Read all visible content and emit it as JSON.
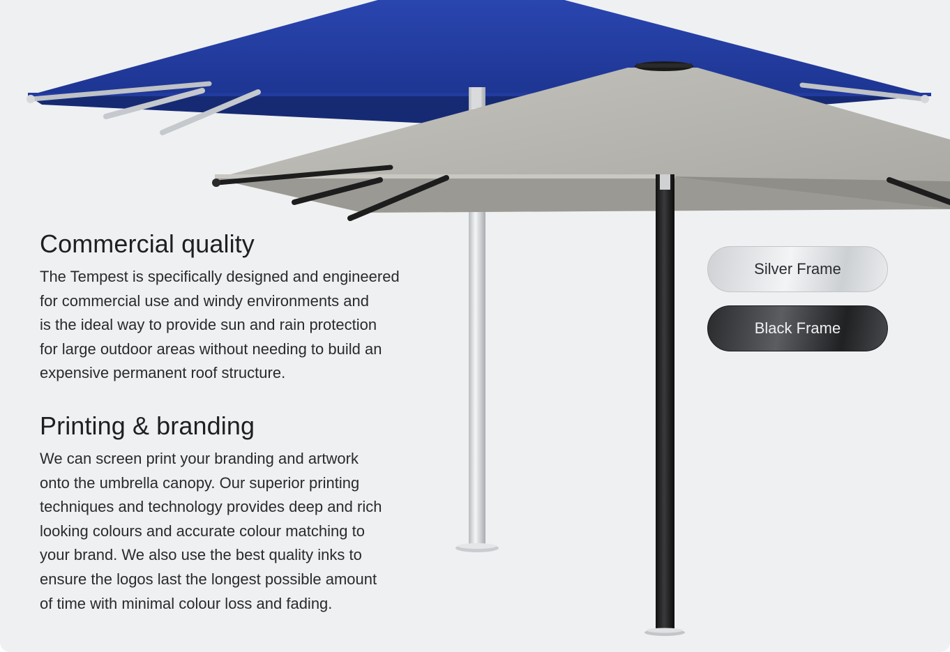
{
  "sections": [
    {
      "heading": "Commercial quality",
      "lines": [
        "The Tempest is specifically designed and engineered",
        "for commercial use and windy environments and",
        "is the ideal way to provide sun and rain protection",
        "for large outdoor areas without needing to build an",
        "expensive permanent roof structure."
      ]
    },
    {
      "heading": "Printing & branding",
      "lines": [
        "We can screen print your branding and artwork",
        "onto the umbrella canopy. Our superior printing",
        "techniques and technology provides deep and rich",
        "looking colours and accurate colour matching to",
        "your brand. We also use the best quality inks to",
        "ensure the logos last the longest possible amount",
        "of time with minimal colour loss and fading."
      ]
    }
  ],
  "frame_options": {
    "silver_label": "Silver Frame",
    "black_label": "Black Frame"
  },
  "colors": {
    "background": "#eff0f2",
    "blue_canopy": "#1f3a9a",
    "grey_canopy": "#b1b0aa",
    "text": "#1f1f21"
  }
}
